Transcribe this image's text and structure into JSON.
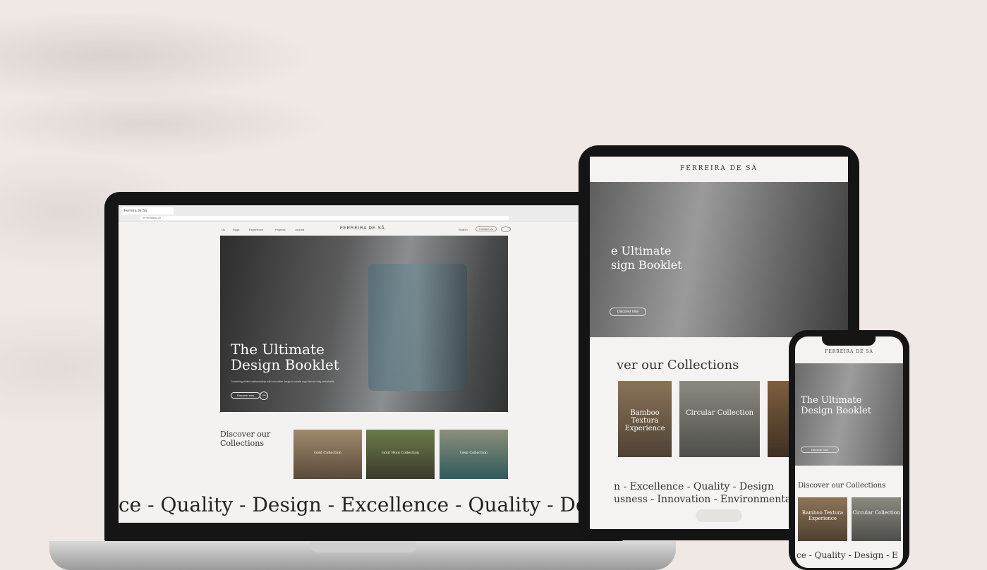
{
  "browser": {
    "tab_title": "Ferreira de Sá",
    "url": "ferreiradesa.pt"
  },
  "site": {
    "logo": "FERREIRA DE SÁ",
    "nav": [
      "Us",
      "Rugs",
      "Experience",
      "Projects",
      "Journal"
    ],
    "search_label": "Search",
    "contact_label": "Contact Us"
  },
  "hero": {
    "title_line1": "The Ultimate",
    "title_line2": "Design Booklet",
    "text": "Combining skilled craftsmanship with innovative design to create rugs that are truly remarkable.",
    "button": "Discover now",
    "arrow": "→"
  },
  "collections": {
    "title_line1": "Discover our",
    "title_line2": "Collections",
    "cards": [
      "Gold Collection",
      "Gold Wool Collection",
      "Gem Collection"
    ]
  },
  "marquee": "ce - Quality - Design - Excellence - Quality - Design",
  "tablet": {
    "logo": "FERREIRA DE SÁ",
    "hero_title_line1": "e Ultimate",
    "hero_title_line2": "sign Booklet",
    "hero_button": "Discover now",
    "collections_title": "ver our Collections",
    "cards": [
      "Bamboo Textura Experience",
      "Circular Collection",
      ""
    ],
    "marquee1": "n - Excellence - Quality - Design",
    "marquee2": "usness - Innovation - Environmental"
  },
  "phone": {
    "logo": "FERREIRA DE SÁ",
    "hero_title_line1": "The Ultimate",
    "hero_title_line2": "Design Booklet",
    "collections_title": "Discover our Collections",
    "cards": [
      "Bamboo Textura Experience",
      "Circular Collection"
    ],
    "marquee": "ce - Quality - Design - E"
  },
  "colors": {
    "background": "#efe8e5",
    "device_frame": "#151515",
    "screen": "#f4f2f0"
  }
}
